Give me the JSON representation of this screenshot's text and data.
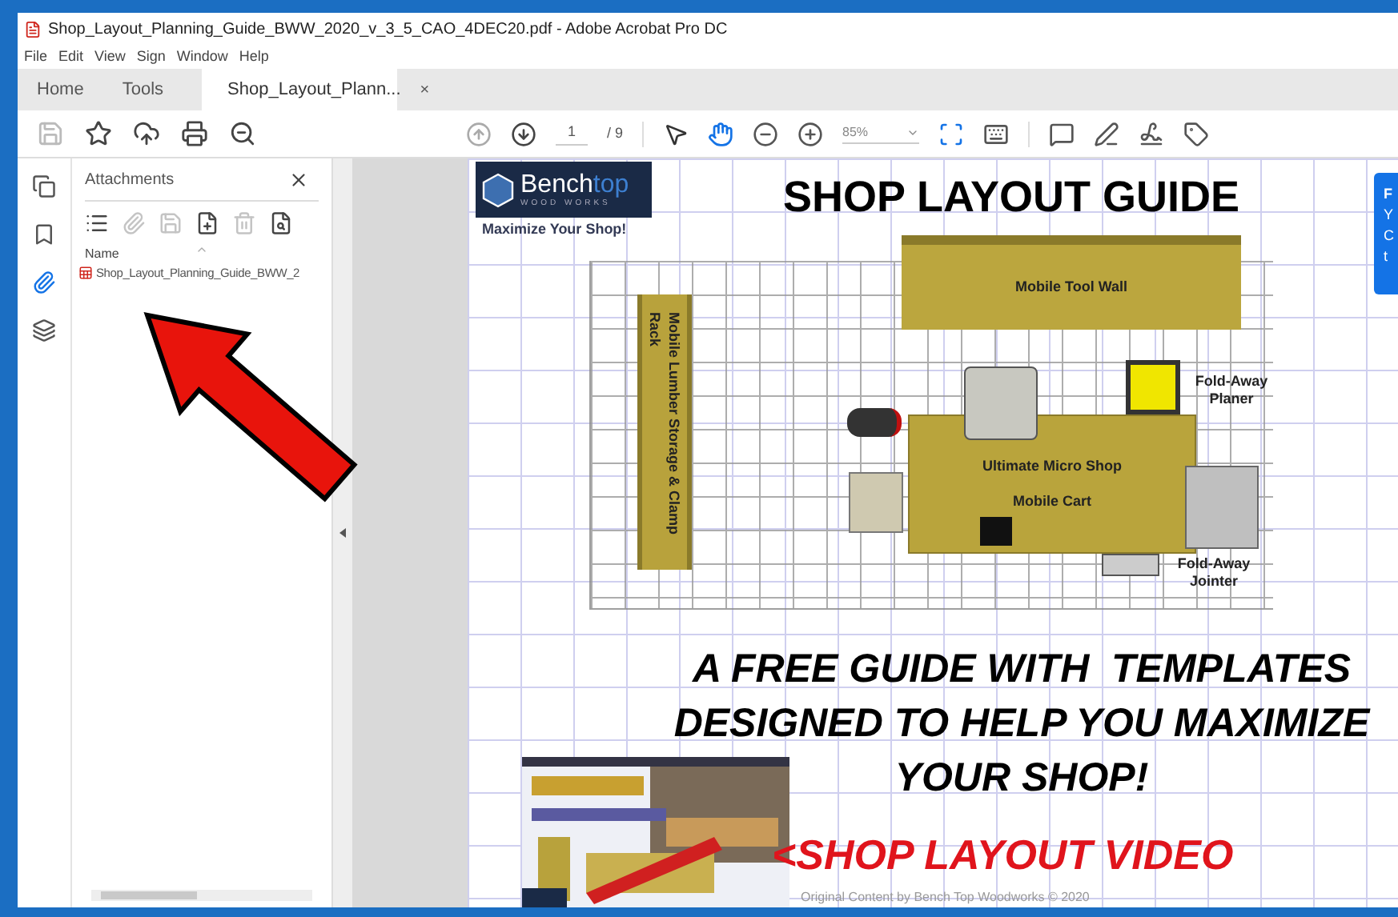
{
  "window": {
    "title": "Shop_Layout_Planning_Guide_BWW_2020_v_3_5_CAO_4DEC20.pdf - Adobe Acrobat Pro DC"
  },
  "menu": [
    "File",
    "Edit",
    "View",
    "Sign",
    "Window",
    "Help"
  ],
  "tabs": [
    {
      "label": "Home",
      "selected": false,
      "kind": "nav"
    },
    {
      "label": "Tools",
      "selected": false,
      "kind": "nav"
    },
    {
      "label": "Shop_Layout_Plann...",
      "selected": true,
      "kind": "document",
      "close": "×"
    }
  ],
  "toolbar": {
    "left": [
      {
        "kind": "save",
        "disabled": true
      },
      {
        "kind": "star",
        "disabled": false
      },
      {
        "kind": "upload",
        "disabled": false
      },
      {
        "kind": "print",
        "disabled": false
      },
      {
        "kind": "zoom",
        "disabled": false
      }
    ],
    "nav": [
      {
        "kind": "prev",
        "disabled": true
      },
      {
        "kind": "next",
        "disabled": false
      }
    ],
    "page_current": "1",
    "page_total": "/ 9",
    "tools": [
      {
        "kind": "select",
        "selected": false
      },
      {
        "kind": "hand",
        "selected": true
      }
    ],
    "zoom": "85%"
  },
  "nav_rail": [
    {
      "kind": "pages",
      "selected": false
    },
    {
      "kind": "bookmarks",
      "selected": false
    },
    {
      "kind": "attachments",
      "selected": true
    },
    {
      "kind": "layers",
      "selected": false
    }
  ],
  "attachments_panel": {
    "title": "Attachments",
    "actions": [
      {
        "kind": "options",
        "disabled": false
      },
      {
        "kind": "attach",
        "disabled": true
      },
      {
        "kind": "save",
        "disabled": true
      },
      {
        "kind": "add",
        "disabled": false
      },
      {
        "kind": "delete",
        "disabled": true
      },
      {
        "kind": "search",
        "disabled": false
      }
    ],
    "column": "Name",
    "files": [
      {
        "name": "Shop_Layout_Planning_Guide_BWW_2"
      }
    ]
  },
  "page": {
    "logo": {
      "word_1": "Bench",
      "word_2": "top",
      "small": "WOOD WORKS"
    },
    "slogan": "Maximize Your Shop!",
    "title": "SHOP LAYOUT GUIDE",
    "layout": [
      {
        "kind": "tool_wall",
        "label": "Mobile Tool Wall"
      },
      {
        "kind": "lumber_rack",
        "label": "Mobile Lumber Storage & Clamp Rack"
      },
      {
        "kind": "cart",
        "label": "Ultimate Micro Shop"
      },
      {
        "kind": "cart_sub",
        "label": "Mobile Cart"
      },
      {
        "kind": "planer",
        "label": "Fold-Away Planer"
      },
      {
        "kind": "jointer",
        "label": "Fold-Away Jointer"
      }
    ],
    "headline": [
      "A FREE GUIDE WITH  TEMPLATES",
      "DESIGNED TO HELP YOU MAXIMIZE",
      "YOUR SHOP!"
    ],
    "video_link": "<SHOP LAYOUT VIDEO",
    "footer": "Original Content by Bench Top Woodworks © 2020",
    "popup_text": [
      "F",
      "Y",
      "C",
      "t"
    ]
  }
}
